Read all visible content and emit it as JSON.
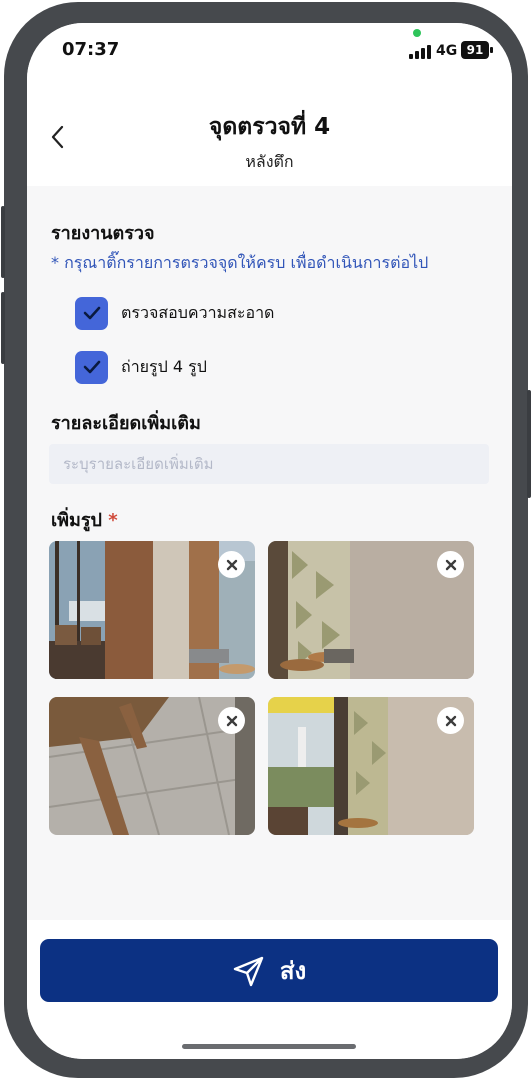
{
  "status_bar": {
    "time": "07:37",
    "network": "4G",
    "battery": "91"
  },
  "header": {
    "title": "จุดตรวจที่ 4",
    "subtitle": "หลังตึก"
  },
  "report": {
    "heading": "รายงานตรวจ",
    "hint": "* กรุณาติ๊กรายการตรวจจุดให้ครบ เพื่อดำเนินการต่อไป",
    "items": [
      {
        "label": "ตรวจสอบความสะอาด",
        "checked": true
      },
      {
        "label": "ถ่ายรูป 4 รูป",
        "checked": true
      }
    ]
  },
  "details": {
    "heading": "รายละเอียดเพิ่มเติม",
    "placeholder": "ระบุรายละเอียดเพิ่มเติม"
  },
  "photos": {
    "heading": "เพิ่มรูป",
    "required_mark": "*",
    "count": 4
  },
  "submit": {
    "label": "ส่ง"
  },
  "colors": {
    "accent": "#0c3183",
    "checkbox": "#4466d9",
    "hint": "#3155b8",
    "required": "#d04a3a"
  }
}
